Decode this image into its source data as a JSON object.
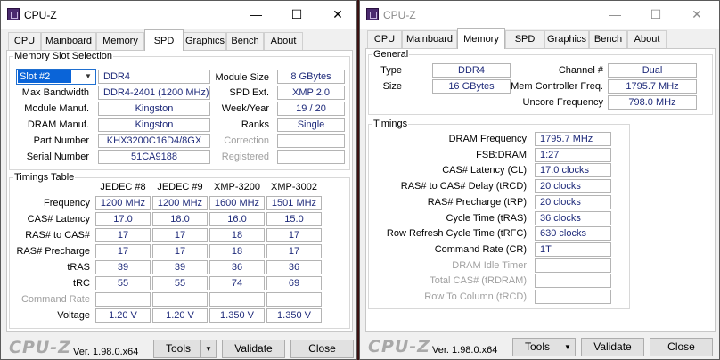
{
  "left": {
    "title": "CPU-Z",
    "tabs": [
      "CPU",
      "Mainboard",
      "Memory",
      "SPD",
      "Graphics",
      "Bench",
      "About"
    ],
    "memory_slot": {
      "group_title": "Memory Slot Selection",
      "slot_selected": "Slot #2",
      "module_type": "DDR4",
      "max_bandwidth_label": "Max Bandwidth",
      "max_bandwidth": "DDR4-2401 (1200 MHz)",
      "module_manuf_label": "Module Manuf.",
      "module_manuf": "Kingston",
      "dram_manuf_label": "DRAM Manuf.",
      "dram_manuf": "Kingston",
      "part_number_label": "Part Number",
      "part_number": "KHX3200C16D4/8GX",
      "serial_number_label": "Serial Number",
      "serial_number": "51CA9188",
      "module_size_label": "Module Size",
      "module_size": "8 GBytes",
      "spd_ext_label": "SPD Ext.",
      "spd_ext": "XMP 2.0",
      "week_year_label": "Week/Year",
      "week_year": "19 / 20",
      "ranks_label": "Ranks",
      "ranks": "Single",
      "correction_label": "Correction",
      "correction": "",
      "registered_label": "Registered",
      "registered": ""
    },
    "timings_table": {
      "group_title": "Timings Table",
      "columns": [
        "JEDEC #8",
        "JEDEC #9",
        "XMP-3200",
        "XMP-3002"
      ],
      "rows": [
        {
          "label": "Frequency",
          "values": [
            "1200 MHz",
            "1200 MHz",
            "1600 MHz",
            "1501 MHz"
          ]
        },
        {
          "label": "CAS# Latency",
          "values": [
            "17.0",
            "18.0",
            "16.0",
            "15.0"
          ]
        },
        {
          "label": "RAS# to CAS#",
          "values": [
            "17",
            "17",
            "18",
            "17"
          ]
        },
        {
          "label": "RAS# Precharge",
          "values": [
            "17",
            "17",
            "18",
            "17"
          ]
        },
        {
          "label": "tRAS",
          "values": [
            "39",
            "39",
            "36",
            "36"
          ]
        },
        {
          "label": "tRC",
          "values": [
            "55",
            "55",
            "74",
            "69"
          ]
        },
        {
          "label": "Command Rate",
          "values": [
            "",
            "",
            "",
            ""
          ]
        },
        {
          "label": "Voltage",
          "values": [
            "1.20 V",
            "1.20 V",
            "1.350 V",
            "1.350 V"
          ]
        }
      ]
    },
    "footer": {
      "logo": "CPU-Z",
      "version": "Ver. 1.98.0.x64",
      "tools": "Tools",
      "validate": "Validate",
      "close": "Close"
    }
  },
  "right": {
    "title": "CPU-Z",
    "tabs": [
      "CPU",
      "Mainboard",
      "Memory",
      "SPD",
      "Graphics",
      "Bench",
      "About"
    ],
    "general": {
      "group_title": "General",
      "type_label": "Type",
      "type": "DDR4",
      "size_label": "Size",
      "size": "16 GBytes",
      "channel_label": "Channel #",
      "channel": "Dual",
      "mem_ctrl_freq_label": "Mem Controller Freq.",
      "mem_ctrl_freq": "1795.7 MHz",
      "uncore_freq_label": "Uncore Frequency",
      "uncore_freq": "798.0 MHz"
    },
    "timings": {
      "group_title": "Timings",
      "rows": [
        {
          "label": "DRAM Frequency",
          "value": "1795.7 MHz"
        },
        {
          "label": "FSB:DRAM",
          "value": "1:27"
        },
        {
          "label": "CAS# Latency (CL)",
          "value": "17.0 clocks"
        },
        {
          "label": "RAS# to CAS# Delay (tRCD)",
          "value": "20 clocks"
        },
        {
          "label": "RAS# Precharge (tRP)",
          "value": "20 clocks"
        },
        {
          "label": "Cycle Time (tRAS)",
          "value": "36 clocks"
        },
        {
          "label": "Row Refresh Cycle Time (tRFC)",
          "value": "630 clocks"
        },
        {
          "label": "Command Rate (CR)",
          "value": "1T"
        },
        {
          "label": "DRAM Idle Timer",
          "value": ""
        },
        {
          "label": "Total CAS# (tRDRAM)",
          "value": ""
        },
        {
          "label": "Row To Column (tRCD)",
          "value": ""
        }
      ]
    },
    "footer": {
      "logo": "CPU-Z",
      "version": "Ver. 1.98.0.x64",
      "tools": "Tools",
      "validate": "Validate",
      "close": "Close"
    }
  },
  "window_controls": {
    "minimize": "—",
    "maximize": "☐",
    "close": "✕"
  },
  "colors": {
    "value_text": "#1e2a7a",
    "selection": "#0a64d8",
    "logo_gray": "#a8a8a8"
  }
}
